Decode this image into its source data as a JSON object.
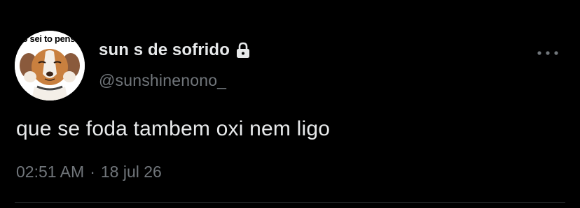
{
  "avatar": {
    "caption": "não sei to pensando"
  },
  "user": {
    "display_name": "sun s de sofrido",
    "handle": "@sunshinenono_",
    "protected_icon": "lock-icon"
  },
  "tweet": {
    "text": "que se foda tambem oxi nem ligo",
    "time": "02:51 AM",
    "separator": "·",
    "date": "18 jul 26"
  },
  "menu": {
    "icon": "more-horizontal-icon"
  },
  "colors": {
    "background": "#000000",
    "primary_text": "#e7e9ea",
    "secondary_text": "#71767b",
    "divider": "#2f3336"
  }
}
